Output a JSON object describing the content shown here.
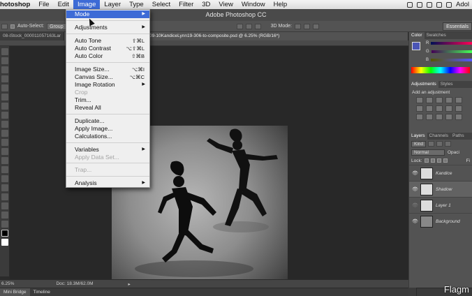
{
  "menubar": {
    "app_name": "hotoshop",
    "items": [
      "File",
      "Edit",
      "Image",
      "Layer",
      "Type",
      "Select",
      "Filter",
      "3D",
      "View",
      "Window",
      "Help"
    ],
    "right_text": "Adol"
  },
  "title_bar": {
    "title": "Adobe Photoshop CC"
  },
  "options_bar": {
    "auto_select_label": "Auto-Select:",
    "auto_select_value": "Group",
    "mode_3d_label": "3D Mode:",
    "workspace": "Essentials"
  },
  "doc_tabs": [
    {
      "label": "08-iStock_000011057163Lar"
    },
    {
      "label": "09-10KandiceLynn19-306-to-composite.psd @ 6.25% (RGB/16*)"
    }
  ],
  "image_menu": {
    "items": [
      {
        "label": "Mode",
        "shortcut": "",
        "submenu": true,
        "highlighted": true,
        "disabled": false,
        "sep_after": true
      },
      {
        "label": "Adjustments",
        "shortcut": "",
        "submenu": true,
        "highlighted": false,
        "disabled": false,
        "sep_after": true
      },
      {
        "label": "Auto Tone",
        "shortcut": "⇧⌘L",
        "submenu": false,
        "highlighted": false,
        "disabled": false,
        "sep_after": false
      },
      {
        "label": "Auto Contrast",
        "shortcut": "⌥⇧⌘L",
        "submenu": false,
        "highlighted": false,
        "disabled": false,
        "sep_after": false
      },
      {
        "label": "Auto Color",
        "shortcut": "⇧⌘B",
        "submenu": false,
        "highlighted": false,
        "disabled": false,
        "sep_after": true
      },
      {
        "label": "Image Size...",
        "shortcut": "⌥⌘I",
        "submenu": false,
        "highlighted": false,
        "disabled": false,
        "sep_after": false
      },
      {
        "label": "Canvas Size...",
        "shortcut": "⌥⌘C",
        "submenu": false,
        "highlighted": false,
        "disabled": false,
        "sep_after": false
      },
      {
        "label": "Image Rotation",
        "shortcut": "",
        "submenu": true,
        "highlighted": false,
        "disabled": false,
        "sep_after": false
      },
      {
        "label": "Crop",
        "shortcut": "",
        "submenu": false,
        "highlighted": false,
        "disabled": true,
        "sep_after": false
      },
      {
        "label": "Trim...",
        "shortcut": "",
        "submenu": false,
        "highlighted": false,
        "disabled": false,
        "sep_after": false
      },
      {
        "label": "Reveal All",
        "shortcut": "",
        "submenu": false,
        "highlighted": false,
        "disabled": false,
        "sep_after": true
      },
      {
        "label": "Duplicate...",
        "shortcut": "",
        "submenu": false,
        "highlighted": false,
        "disabled": false,
        "sep_after": false
      },
      {
        "label": "Apply Image...",
        "shortcut": "",
        "submenu": false,
        "highlighted": false,
        "disabled": false,
        "sep_after": false
      },
      {
        "label": "Calculations...",
        "shortcut": "",
        "submenu": false,
        "highlighted": false,
        "disabled": false,
        "sep_after": true
      },
      {
        "label": "Variables",
        "shortcut": "",
        "submenu": true,
        "highlighted": false,
        "disabled": false,
        "sep_after": false
      },
      {
        "label": "Apply Data Set...",
        "shortcut": "",
        "submenu": false,
        "highlighted": false,
        "disabled": true,
        "sep_after": true
      },
      {
        "label": "Trap...",
        "shortcut": "",
        "submenu": false,
        "highlighted": false,
        "disabled": true,
        "sep_after": true
      },
      {
        "label": "Analysis",
        "shortcut": "",
        "submenu": true,
        "highlighted": false,
        "disabled": false,
        "sep_after": false
      }
    ]
  },
  "status_bar": {
    "zoom": "6.25%",
    "doc_info": "Doc: 18.3M/62.0M"
  },
  "bottom_tabs": [
    "Mini Bridge",
    "Timeline"
  ],
  "watermark": "Flagm",
  "panels": {
    "color_tabs": [
      "Color",
      "Swatches"
    ],
    "color_labels": [
      "R",
      "G",
      "B"
    ],
    "adjust_tabs": [
      "Adjustments",
      "Styles"
    ],
    "adjust_title": "Add an adjustment",
    "layers_tabs": [
      "Layers",
      "Channels",
      "Paths"
    ],
    "kind_label": "Kind",
    "blend_mode": "Normal",
    "opacity_label": "Opaci",
    "lock_label": "Lock:",
    "fill_label": "Fi",
    "layers": [
      {
        "name": "Kandice",
        "selected": false
      },
      {
        "name": "Shadow",
        "selected": true
      },
      {
        "name": "Layer 1",
        "selected": false
      },
      {
        "name": "Background",
        "selected": false
      }
    ]
  },
  "colors": {
    "menu_highlight": "#3d6bd6",
    "ps_dark": "#2b2b2b",
    "panel": "#535353"
  }
}
